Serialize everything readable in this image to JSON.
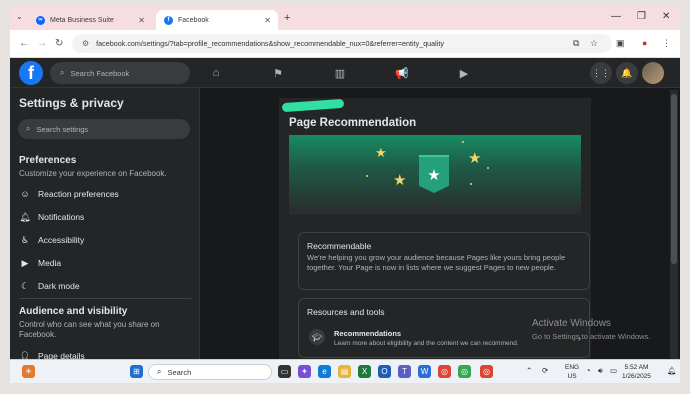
{
  "browser": {
    "tabs": [
      {
        "label": "Meta Business Suite",
        "active": false
      },
      {
        "label": "Facebook",
        "active": true
      }
    ],
    "url": "facebook.com/settings/?tab=profile_recommendations&show_recommendable_nux=0&referrer=entity_quality"
  },
  "fb": {
    "search_placeholder": "Search Facebook",
    "nav_icons": [
      "home-icon",
      "flag-icon",
      "chart-icon",
      "megaphone-icon",
      "video-icon"
    ]
  },
  "sidebar": {
    "title": "Settings & privacy",
    "search_placeholder": "Search settings",
    "preferences": {
      "heading": "Preferences",
      "sub": "Customize your experience on Facebook.",
      "items": [
        {
          "label": "Reaction preferences",
          "icon": "reaction-icon"
        },
        {
          "label": "Notifications",
          "icon": "bell-icon"
        },
        {
          "label": "Accessibility",
          "icon": "accessibility-icon"
        },
        {
          "label": "Media",
          "icon": "media-icon"
        },
        {
          "label": "Dark mode",
          "icon": "moon-icon"
        }
      ]
    },
    "audience": {
      "heading": "Audience and visibility",
      "sub": "Control who can see what you share on Facebook.",
      "items": [
        {
          "label": "Page details",
          "icon": "person-icon"
        }
      ]
    }
  },
  "main": {
    "title": "Page Recommendation",
    "recommendable": {
      "title": "Recommendable",
      "text": "We're helping you grow your audience because Pages like yours bring people together. Your Page is now in lists where we suggest Pages to new people."
    },
    "resources": {
      "title": "Resources and tools",
      "item_title": "Recommendations",
      "item_desc": "Learn more about eligibility and the content we can recommend."
    }
  },
  "watermark": {
    "line1": "Activate Windows",
    "line2": "Go to Settings to activate Windows."
  },
  "taskbar": {
    "search_placeholder": "Search",
    "lang_line1": "ENG",
    "lang_line2": "US",
    "time": "5:52 AM",
    "date": "1/26/2025"
  }
}
